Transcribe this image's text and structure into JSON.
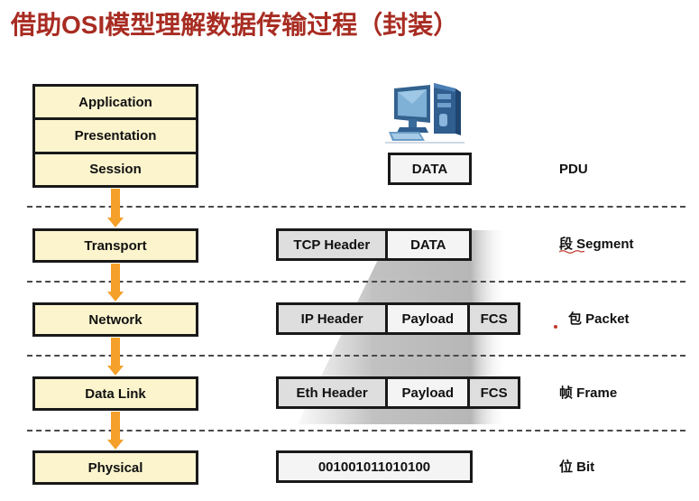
{
  "title": "借助OSI模型理解数据传输过程（封装）",
  "theme": {
    "title_color": "#a82c22",
    "layer_fill": "#fbf4cd",
    "border_color": "#191919",
    "arrow_color": "#f5a02a",
    "header_cell_fill": "#dedede",
    "data_cell_fill": "#f4f4f4",
    "annotation_red": "#c0392b",
    "pc_icon_blue": "#2e5f92"
  },
  "icons": {
    "computer": "desktop-computer-icon"
  },
  "osi_layers": {
    "upper_group": [
      {
        "label": "Application"
      },
      {
        "label": "Presentation"
      },
      {
        "label": "Session"
      }
    ],
    "lower": [
      {
        "label": "Transport"
      },
      {
        "label": "Network"
      },
      {
        "label": "Data Link"
      },
      {
        "label": "Physical"
      }
    ]
  },
  "pdu_rows": [
    {
      "layer": "Session",
      "name": "PDU",
      "cells": [
        {
          "text": "DATA",
          "kind": "data"
        }
      ]
    },
    {
      "layer": "Transport",
      "name": "段 Segment",
      "cells": [
        {
          "text": "TCP Header",
          "kind": "header"
        },
        {
          "text": "DATA",
          "kind": "data"
        }
      ]
    },
    {
      "layer": "Network",
      "name": "包 Packet",
      "cells": [
        {
          "text": "IP Header",
          "kind": "header"
        },
        {
          "text": "Payload",
          "kind": "data"
        },
        {
          "text": "FCS",
          "kind": "header"
        }
      ]
    },
    {
      "layer": "Data Link",
      "name": "帧 Frame",
      "cells": [
        {
          "text": "Eth Header",
          "kind": "header"
        },
        {
          "text": "Payload",
          "kind": "data"
        },
        {
          "text": "FCS",
          "kind": "header"
        }
      ]
    },
    {
      "layer": "Physical",
      "name": "位 Bit",
      "cells": [
        {
          "text": "001001011010100",
          "kind": "data"
        }
      ]
    }
  ],
  "pdu_labels": {
    "pdu": "PDU",
    "segment": "段 Segment",
    "packet": "包 Packet",
    "frame": "帧 Frame",
    "bit": "位 Bit"
  },
  "pdu_cells": {
    "data": "DATA",
    "tcp_header": "TCP Header",
    "ip_header": "IP Header",
    "eth_header": "Eth Header",
    "payload": "Payload",
    "fcs": "FCS",
    "bits": "001001011010100"
  }
}
